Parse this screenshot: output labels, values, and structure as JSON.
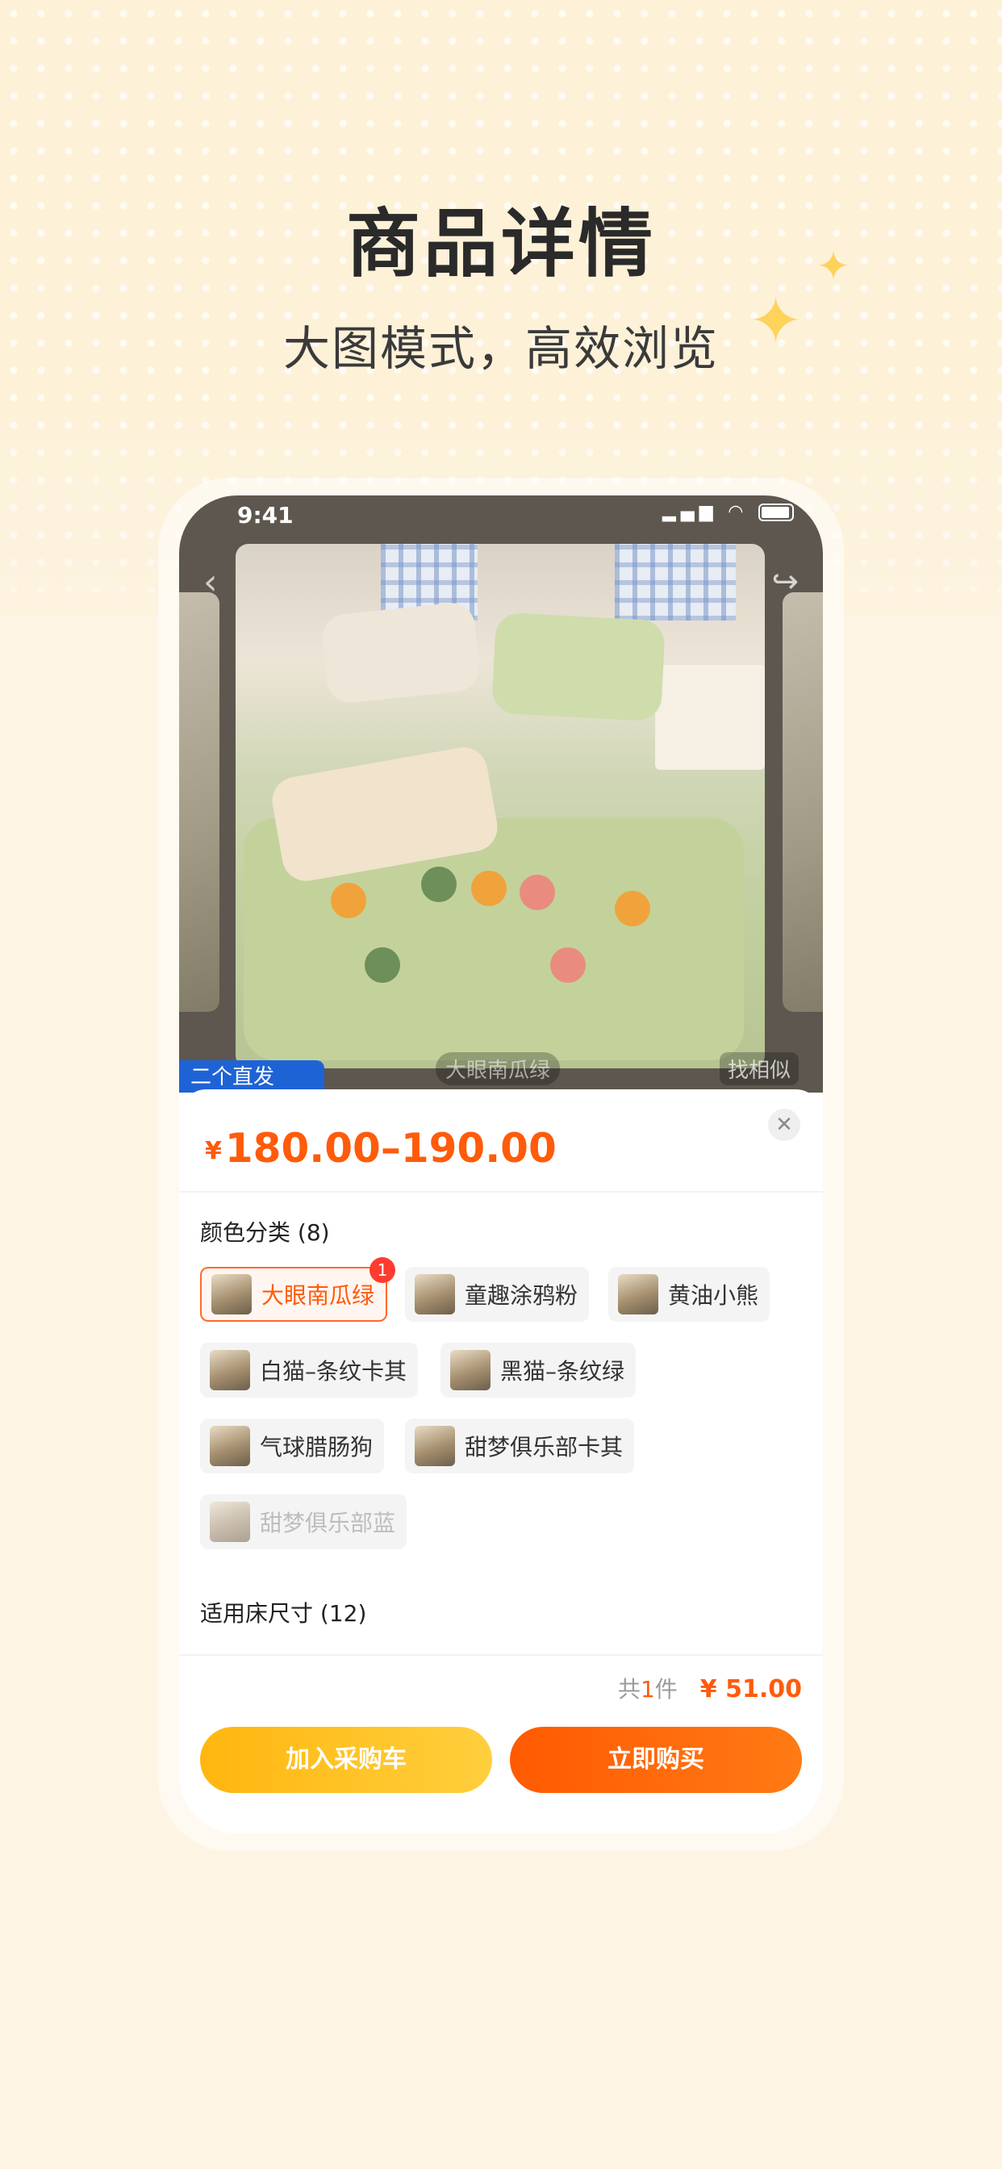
{
  "promo": {
    "title": "商品详情",
    "subtitle": "大图模式，高效浏览"
  },
  "status_bar": {
    "time": "9:41"
  },
  "photo": {
    "caption": "大眼南瓜绿",
    "find_similar": "找相似",
    "tag": "二个直发"
  },
  "product": {
    "currency": "¥",
    "price_range": "180.00–190.00"
  },
  "color_section": {
    "label": "颜色分类 (8)",
    "options": [
      {
        "label": "大眼南瓜绿",
        "state": "selected",
        "badge": "1"
      },
      {
        "label": "童趣涂鸦粉",
        "state": "normal"
      },
      {
        "label": "黄油小熊",
        "state": "normal"
      },
      {
        "label": "白猫–条纹卡其",
        "state": "normal"
      },
      {
        "label": "黑猫–条纹绿",
        "state": "normal"
      },
      {
        "label": "气球腊肠狗",
        "state": "normal"
      },
      {
        "label": "甜梦俱乐部卡其",
        "state": "normal"
      },
      {
        "label": "甜梦俱乐部蓝",
        "state": "disabled"
      }
    ]
  },
  "size_section": {
    "label": "适用床尺寸 (12)"
  },
  "summary": {
    "prefix": "共",
    "count": "1",
    "suffix": "件",
    "total": "¥ 51.00"
  },
  "actions": {
    "add_to_cart": "加入采购车",
    "buy_now": "立即购买"
  },
  "colors": {
    "accent": "#ff5b0a",
    "cart_button": "#ffb60f",
    "buy_button": "#ff5a00",
    "badge": "#ff3b30"
  }
}
